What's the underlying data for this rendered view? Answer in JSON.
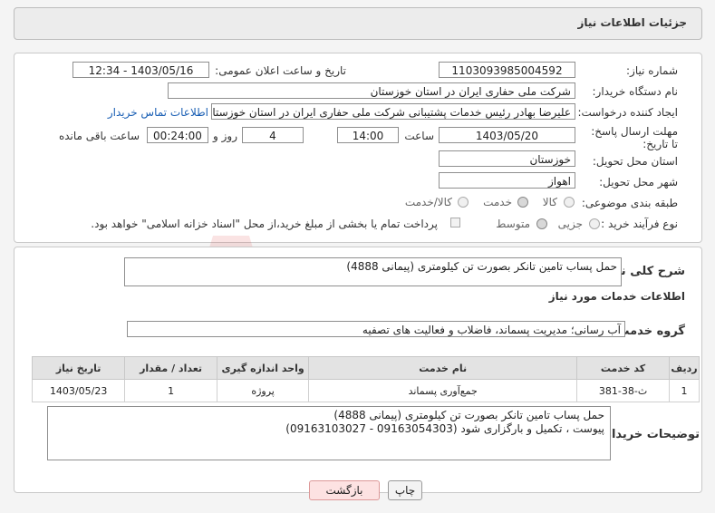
{
  "header": {
    "title": "جزئیات اطلاعات نیاز"
  },
  "fields": {
    "need_number_label": "شماره نیاز:",
    "need_number": "1103093985004592",
    "announce_label": "تاریخ و ساعت اعلان عمومی:",
    "announce_value": "1403/05/16 - 12:34",
    "buyer_org_label": "نام دستگاه خریدار:",
    "buyer_org": "شرکت ملی حفاری ایران در استان خوزستان",
    "creator_label": "ایجاد کننده درخواست:",
    "creator": "علیرضا بهادر رئیس خدمات پشتیبانی شرکت ملی حفاری ایران در استان خوزستان",
    "contact_link": "اطلاعات تماس خریدار",
    "deadline_label": "مهلت ارسال پاسخ: تا تاریخ:",
    "deadline_date": "1403/05/20",
    "time_label": "ساعت",
    "deadline_time": "14:00",
    "days_value": "4",
    "days_label": "روز و",
    "remaining_time": "00:24:00",
    "remaining_label": "ساعت باقی مانده",
    "province_label": "استان محل تحویل:",
    "province": "خوزستان",
    "city_label": "شهر محل تحویل:",
    "city": "اهواز",
    "category_label": "طبقه بندی موضوعی:",
    "category_options": [
      "کالا",
      "خدمت",
      "کالا/خدمت"
    ],
    "process_label": "نوع فرآیند خرید :",
    "process_options": [
      "جزیی",
      "متوسط"
    ],
    "payment_note": "پرداخت تمام یا بخشی از مبلغ خرید،از محل \"اسناد خزانه اسلامی\" خواهد بود."
  },
  "summary": {
    "label": "شرح کلی نیاز:",
    "value": "حمل پساب تامین تانکر بصورت تن کیلومتری (پیمانی 4888)"
  },
  "services": {
    "section_title": "اطلاعات خدمات مورد نیاز",
    "group_label": "گروه خدمت:",
    "group_value": "آب رسانی؛ مدیریت پسماند، فاضلاب و فعالیت های تصفیه",
    "columns": [
      "ردیف",
      "کد خدمت",
      "نام خدمت",
      "واحد اندازه گیری",
      "تعداد / مقدار",
      "تاریخ نیاز"
    ],
    "rows": [
      [
        "1",
        "ث-38-381",
        "جمع‌آوری پسماند",
        "پروژه",
        "1",
        "1403/05/23"
      ]
    ]
  },
  "buyer_notes": {
    "label": "توضیحات خریدار:",
    "line1": "حمل پساب تامین تانکر بصورت تن کیلومتری (پیمانی 4888)",
    "line2": "پیوست ، تکمیل و بارگزاری شود (09163054303 - 09163103027)"
  },
  "buttons": {
    "print": "چاپ",
    "back": "بازگشت"
  },
  "colors": {
    "link": "#1a5fb4",
    "back_bg": "#fde2e2",
    "header_bg": "#ececec"
  }
}
